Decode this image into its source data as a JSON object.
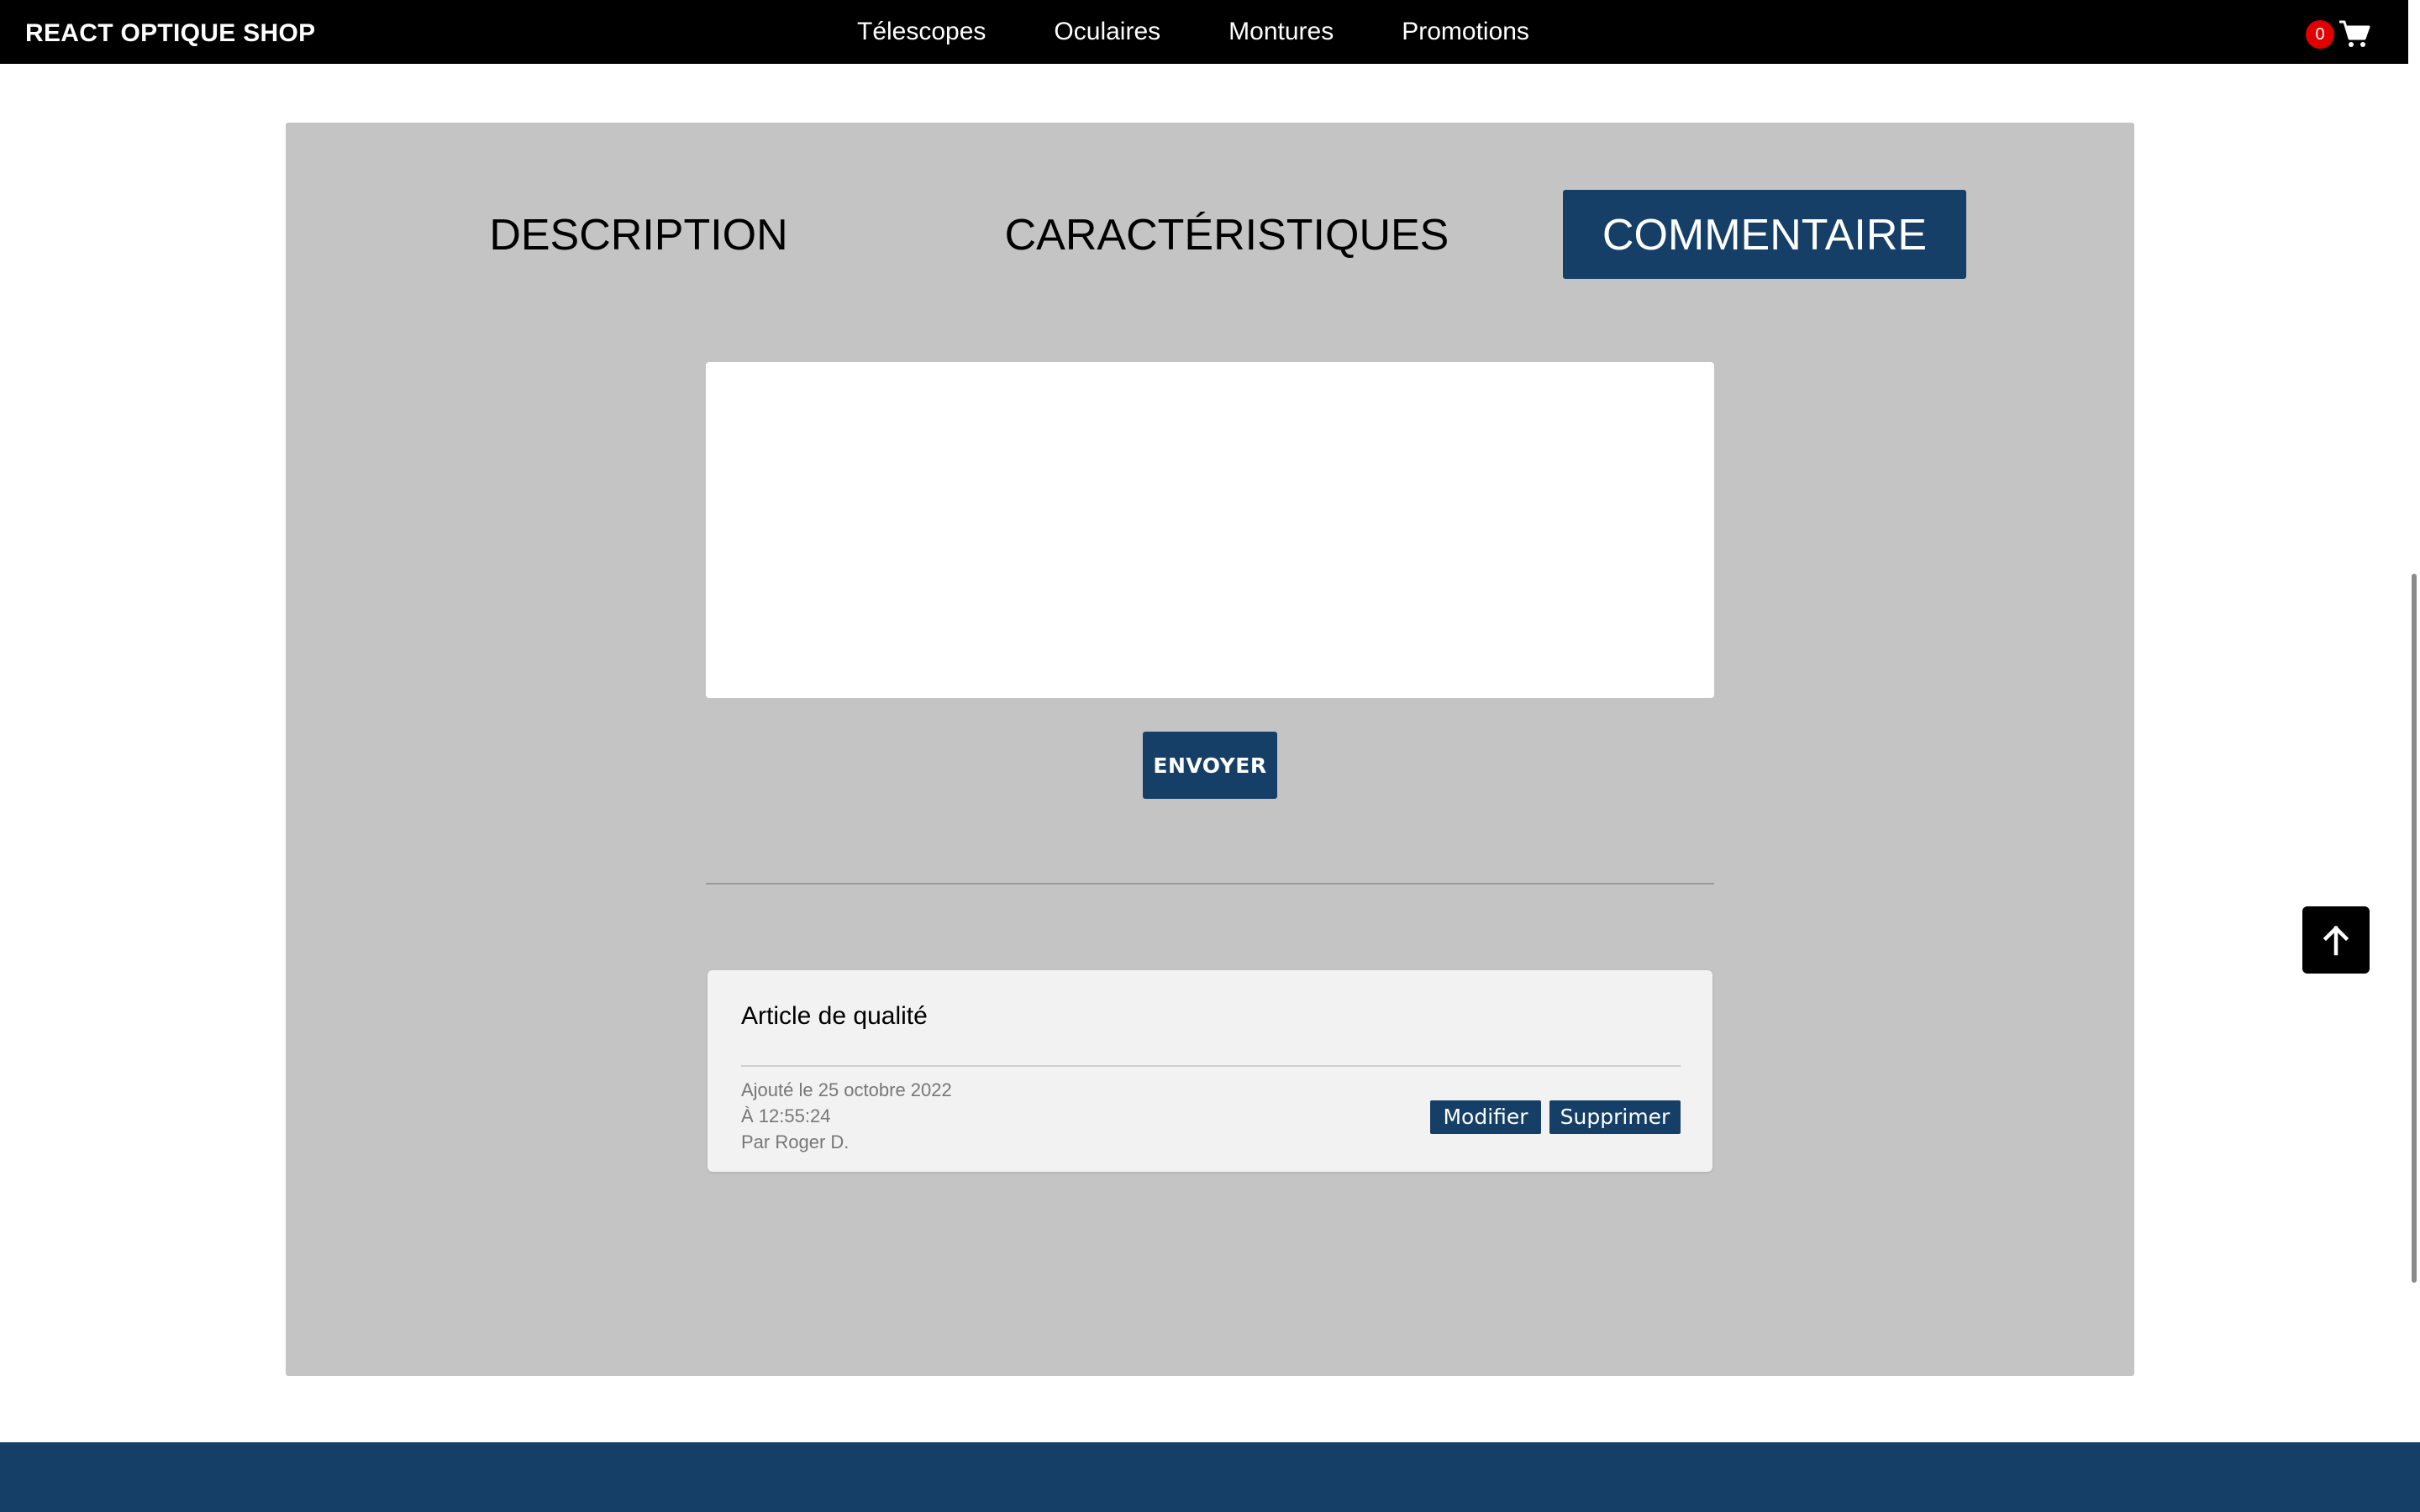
{
  "header": {
    "brand": "REACT OPTIQUE SHOP",
    "nav": [
      {
        "label": "Télescopes"
      },
      {
        "label": "Oculaires"
      },
      {
        "label": "Montures"
      },
      {
        "label": "Promotions"
      }
    ],
    "cart_count": "0",
    "cart_icon": "shopping-cart-icon"
  },
  "tabs": {
    "description": "DESCRIPTION",
    "caracteristiques": "CARACTÉRISTIQUES",
    "commentaire": "COMMENTAIRE",
    "active": "commentaire"
  },
  "comment_form": {
    "value": "",
    "placeholder": "",
    "submit_label": "ENVOYER"
  },
  "comments": [
    {
      "title": "Article de qualité",
      "date": "Ajouté le 25 octobre 2022",
      "time": "À 12:55:24",
      "author": "Par Roger D.",
      "edit_label": "Modifier",
      "delete_label": "Supprimer"
    }
  ],
  "back_to_top_icon": "arrow-up-icon",
  "colors": {
    "navbar": "#000000",
    "accent": "#163f68",
    "panel": "#c4c4c4",
    "badge": "#e00000"
  }
}
